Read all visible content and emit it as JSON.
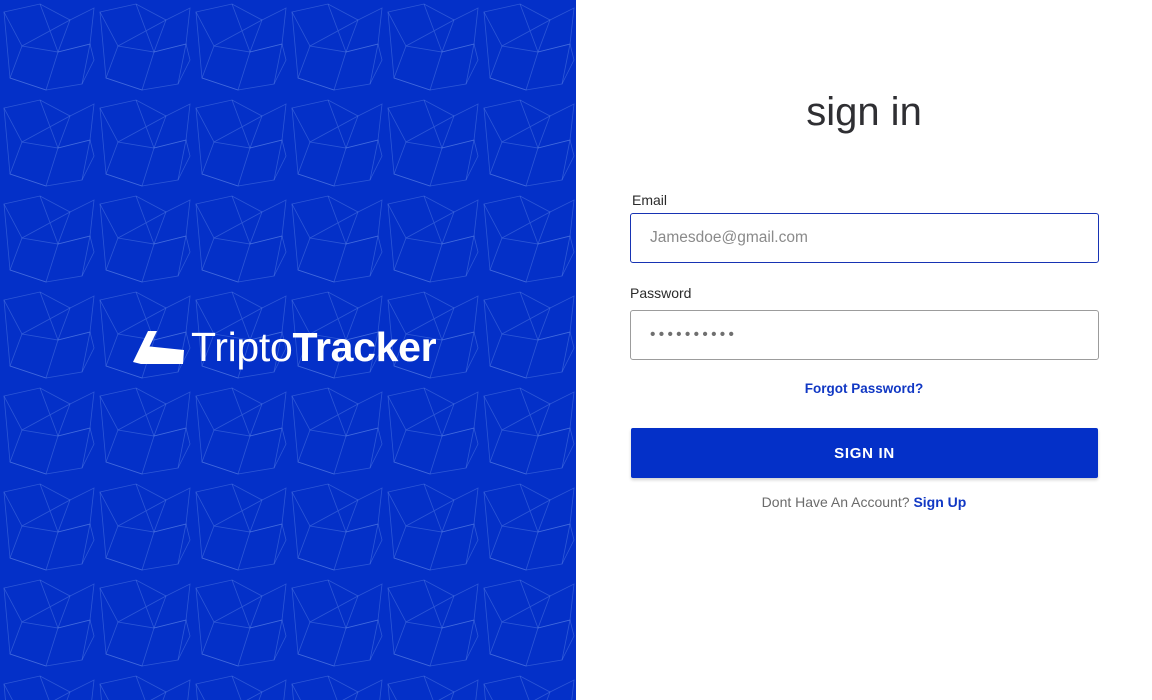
{
  "brand": {
    "name_light": "Tripto",
    "name_bold": "Tracker",
    "bg_color": "#0430c8"
  },
  "form": {
    "title": "sign in",
    "email_label": "Email",
    "email_placeholder": "Jamesdoe@gmail.com",
    "password_label": "Password",
    "password_value": "••••••••••",
    "forgot_link": "Forgot Password?",
    "submit_label": "SIGN  IN",
    "signup_prompt": "Dont Have An Account?",
    "signup_link": "Sign Up",
    "accent_color": "#1138c4"
  }
}
